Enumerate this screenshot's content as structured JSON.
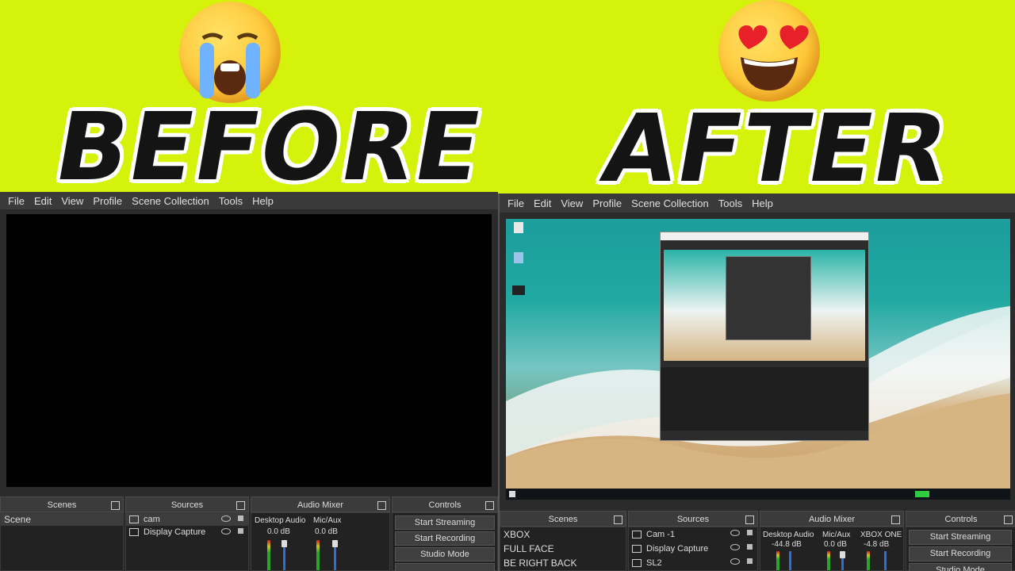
{
  "banner": {
    "before": "BEFORE",
    "after": "AFTER"
  },
  "icons": {
    "crying": "loudly-crying-face-emoji",
    "love": "heart-eyes-emoji"
  },
  "menu": [
    "File",
    "Edit",
    "View",
    "Profile",
    "Scene Collection",
    "Tools",
    "Help"
  ],
  "before": {
    "docks": {
      "scenes": "Scenes",
      "sources": "Sources",
      "mixer": "Audio Mixer",
      "controls": "Controls"
    },
    "scenes": [
      "Scene"
    ],
    "sources": [
      "cam",
      "Display Capture"
    ],
    "mixer": [
      {
        "name": "Desktop Audio",
        "db": "0.0 dB"
      },
      {
        "name": "Mic/Aux",
        "db": "0.0 dB"
      }
    ],
    "controls": [
      "Start Streaming",
      "Start Recording",
      "Studio Mode"
    ]
  },
  "after": {
    "docks": {
      "scenes": "Scenes",
      "sources": "Sources",
      "mixer": "Audio Mixer",
      "controls": "Controls"
    },
    "scenes": [
      "XBOX",
      "FULL FACE",
      "BE RIGHT BACK"
    ],
    "sources": [
      "Cam -1",
      "Display Capture",
      "SL2"
    ],
    "mixer": [
      {
        "name": "Desktop Audio",
        "db": "-44.8 dB"
      },
      {
        "name": "Mic/Aux",
        "db": "0.0 dB"
      },
      {
        "name": "XBOX ONE",
        "db": "-4.8 dB"
      }
    ],
    "controls": [
      "Start Streaming",
      "Start Recording",
      "Studio Mode"
    ]
  }
}
